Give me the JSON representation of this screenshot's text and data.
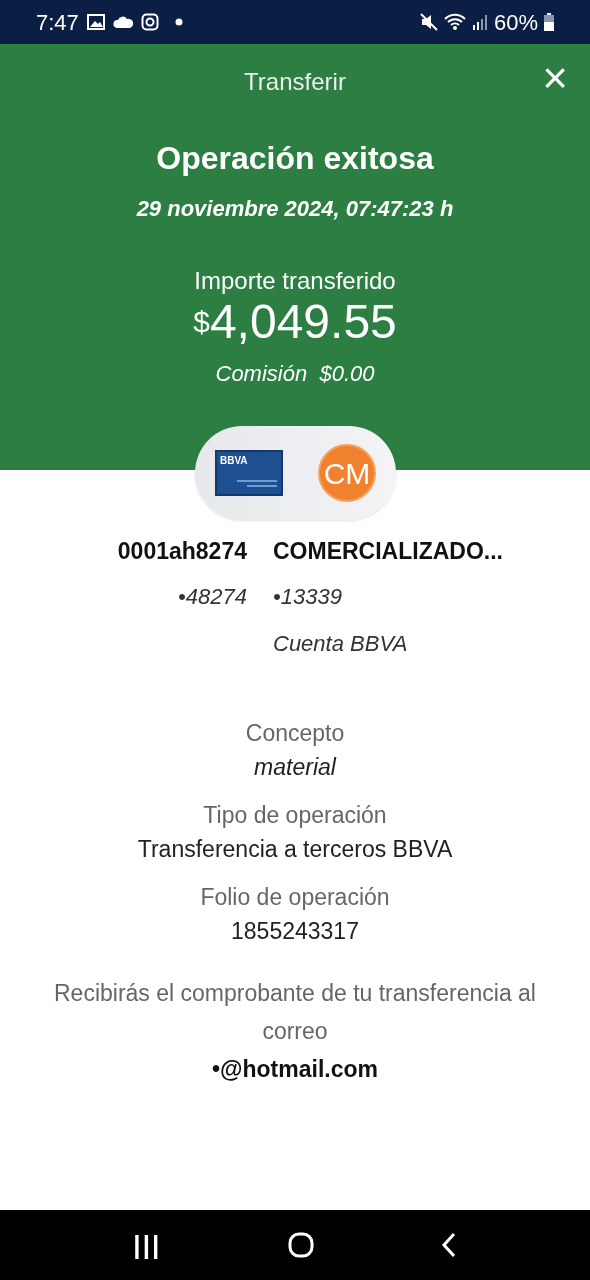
{
  "status_bar": {
    "time": "7:47",
    "battery": "60%"
  },
  "header": {
    "title": "Transferir",
    "close": "×",
    "result": "Operación exitosa",
    "datetime": "29 noviembre 2024, 07:47:23 h",
    "amount_label": "Importe transferido",
    "currency": "$",
    "amount": "4,049.55",
    "fee": "Comisión  $0.00"
  },
  "accounts": {
    "card_label": "BBVA",
    "recipient_initials": "CM",
    "origin": {
      "name": "0001ah8274",
      "number": "•48274"
    },
    "destination": {
      "name": "COMERCIALIZADO...",
      "number": "•13339",
      "bank": "Cuenta BBVA"
    }
  },
  "details": [
    {
      "label": "Concepto",
      "value": "material",
      "italic": true
    },
    {
      "label": "Tipo de operación",
      "value": "Transferencia a terceros BBVA",
      "italic": false
    },
    {
      "label": "Folio de operación",
      "value": "1855243317",
      "italic": false
    }
  ],
  "notice": {
    "text": "Recibirás el comprobante de tu transferencia al correo",
    "email": "•@hotmail.com"
  },
  "nav_bar": {
    "recents": "|||"
  }
}
